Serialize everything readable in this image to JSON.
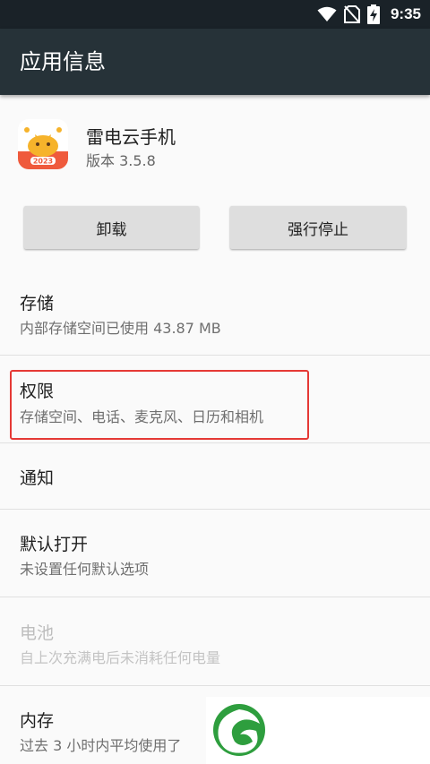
{
  "status_bar": {
    "time": "9:35",
    "battery_glyph": "⚡"
  },
  "app_bar": {
    "title": "应用信息"
  },
  "app": {
    "name": "雷电云手机",
    "version": "版本 3.5.8",
    "icon_badge": "2023",
    "icon_color": "#ef5a3c"
  },
  "buttons": {
    "uninstall": "卸载",
    "force_stop": "强行停止"
  },
  "items": [
    {
      "title": "存储",
      "subtitle": "内部存储空间已使用 43.87 MB"
    },
    {
      "title": "权限",
      "subtitle": "存储空间、电话、麦克风、日历和相机"
    },
    {
      "title": "通知"
    },
    {
      "title": "默认打开",
      "subtitle": "未设置任何默认选项"
    },
    {
      "title": "电池",
      "subtitle": "自上次充满电后未消耗任何电量"
    },
    {
      "title": "内存",
      "subtitle": "过去 3 小时内平均使用了"
    }
  ],
  "colors": {
    "app_bar": "#263238",
    "status_bar": "#1a2228",
    "highlight": "#e53935",
    "watermark_green": "#2e9e3e"
  },
  "icons": [
    "wifi-icon",
    "no-sim-icon",
    "battery-charging-icon",
    "back-icon"
  ]
}
